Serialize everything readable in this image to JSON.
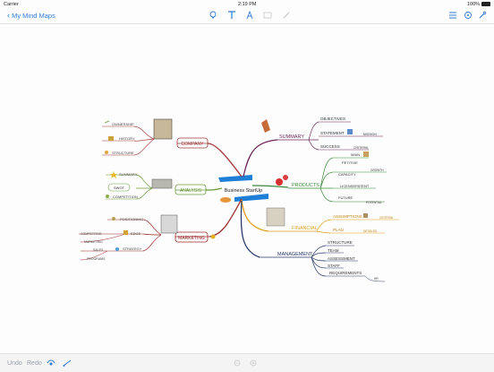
{
  "status": {
    "carrier": "Carrier",
    "time": "2:19 PM",
    "battery": "100%"
  },
  "nav": {
    "back_label": "My Mind Maps"
  },
  "colors": {
    "accent": "#2f7bd9",
    "company": "#a23b3b",
    "analysis": "#6a9a3a",
    "marketing": "#9b2a2a",
    "summary": "#6b2a5b",
    "products": "#3a8a3a",
    "financial": "#e0a020",
    "management": "#2a3a6a"
  },
  "map": {
    "central": "Business StartUp",
    "central_sub": "",
    "left": [
      {
        "label": "COMPANY",
        "children": [
          "OWNERSHIP",
          "HISTORY",
          "STRUCTURE"
        ]
      },
      {
        "label": "ANALYSIS",
        "children": [
          "SUMMARY",
          "SWOT",
          "COMPETITION"
        ]
      },
      {
        "label": "MARKETING",
        "children": [
          "POSITIONING",
          "EDGE",
          "COMPETITIVE",
          "MARKETING",
          "SALES",
          "STRATEGY",
          "PROGRAMS"
        ]
      }
    ],
    "right": [
      {
        "label": "SUMMARY",
        "children": [
          "OBJECTIVES",
          "STATEMENT",
          "MISSION",
          "SUCCESS",
          "CRITERIA"
        ]
      },
      {
        "label": "PRODUCTS",
        "children": [
          "MAIN",
          "PETITIVE",
          "GROWTH",
          "CAPACITY",
          "LICENSEPATENT",
          "FUTURE",
          "POTENTIAL"
        ]
      },
      {
        "label": "FINANCIAL",
        "children": [
          "ASSUMPTIONS",
          "CRITERIA",
          "PLAN",
          "DETAILED"
        ]
      },
      {
        "label": "MANAGEMENT",
        "children": [
          "STRUCTURE",
          "TEAM",
          "ASSESSMENT",
          "STAFF",
          "REQUIREMENTS",
          "HR"
        ]
      }
    ]
  },
  "bottom": {
    "undo": "Undo",
    "redo": "Redo"
  }
}
